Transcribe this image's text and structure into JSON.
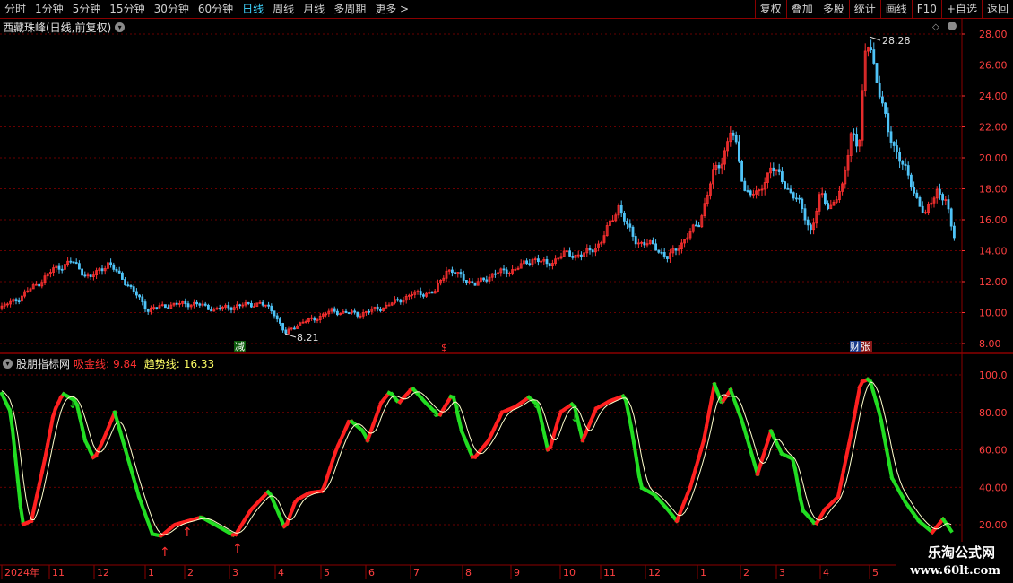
{
  "toolbar": {
    "periods": [
      "分时",
      "1分钟",
      "5分钟",
      "15分钟",
      "30分钟",
      "60分钟",
      "日线",
      "周线",
      "月线",
      "多周期",
      "更多 >"
    ],
    "active_period": "日线",
    "right_buttons": [
      "复权",
      "叠加",
      "多股",
      "统计",
      "画线",
      "F10",
      "+自选",
      "返回"
    ]
  },
  "main_chart": {
    "title": "西藏珠峰(日线,前复权)",
    "y_ticks": [
      "28.00",
      "26.00",
      "24.00",
      "22.00",
      "20.00",
      "18.00",
      "16.00",
      "14.00",
      "12.00",
      "10.00",
      "8.00"
    ],
    "high_label": "28.28",
    "low_label": "8.21",
    "markers": {
      "reduce": "减",
      "dollar": "$",
      "cai": "财",
      "zhang": "张"
    }
  },
  "indicator": {
    "name": "股朋指标网",
    "line1_label": "吸金线:",
    "line1_value": "9.84",
    "line2_label": "趋势线:",
    "line2_value": "16.33",
    "y_ticks": [
      "100.0",
      "80.00",
      "60.00",
      "40.00",
      "20.00"
    ]
  },
  "time_axis": [
    "2024年",
    "11",
    "12",
    "1",
    "2",
    "3",
    "4",
    "5",
    "6",
    "7",
    "8",
    "9",
    "10",
    "11",
    "12",
    "1",
    "2",
    "3",
    "4",
    "5"
  ],
  "watermark": {
    "line1": "乐淘公式网",
    "line2": "www.60lt.com"
  },
  "colors": {
    "up": "#ff3030",
    "down": "#4fc3f7",
    "ind_up": "#ff2020",
    "ind_down": "#22dd22",
    "grid": "#8b0000"
  }
}
